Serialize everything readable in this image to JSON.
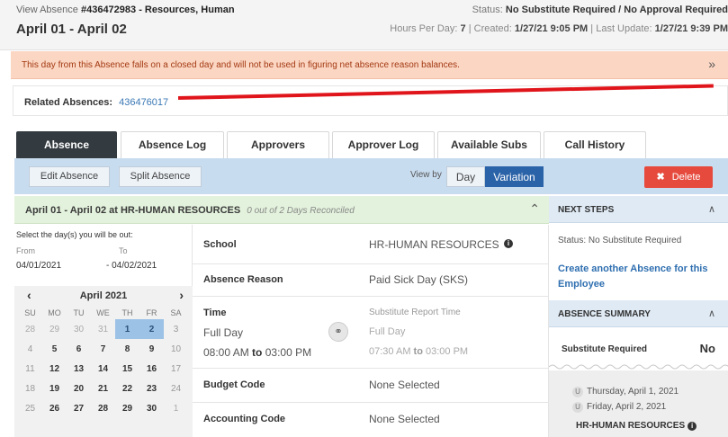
{
  "header": {
    "view_label": "View Absence",
    "absence_id": "#436472983 - Resources, Human",
    "title": "April 01 - April 02",
    "status_label": "Status:",
    "status_value": "No Substitute Required  / No Approval Required",
    "hours_label": "Hours Per Day:",
    "hours_value": "7",
    "created_label": "| Created:",
    "created_value": "1/27/21 9:05 PM",
    "updated_label": "| Last Update:",
    "updated_value": "1/27/21 9:39 PM"
  },
  "warning": {
    "message": "This day from this Absence falls on a closed day and will not be used in figuring net absence reason balances.",
    "icon": "double-chevron-down-icon"
  },
  "related": {
    "label": "Related Absences:",
    "link": "436476017"
  },
  "tabs": [
    {
      "label": "Absence",
      "active": true
    },
    {
      "label": "Absence Log"
    },
    {
      "label": "Approvers"
    },
    {
      "label": "Approver Log"
    },
    {
      "label": "Available Subs"
    },
    {
      "label": "Call History"
    }
  ],
  "toolbar": {
    "edit_label": "Edit Absence",
    "split_label": "Split Absence",
    "view_by_label": "View by",
    "day_label": "Day",
    "variation_label": "Variation",
    "delete_label": "Delete"
  },
  "section": {
    "title": "April 01 - April 02 at HR-HUMAN RESOURCES",
    "subtitle": "0 out of 2 Days Reconciled"
  },
  "dates": {
    "prompt": "Select the day(s) you will be out:",
    "from_label": "From",
    "to_label": "To",
    "from_value": "04/01/2021",
    "to_value": "- 04/02/2021"
  },
  "calendar": {
    "month": "April 2021",
    "weekdays": [
      "SU",
      "MO",
      "TU",
      "WE",
      "TH",
      "FR",
      "SA"
    ],
    "weeks": [
      [
        "28",
        "29",
        "30",
        "31",
        "1",
        "2",
        "3"
      ],
      [
        "4",
        "5",
        "6",
        "7",
        "8",
        "9",
        "10"
      ],
      [
        "11",
        "12",
        "13",
        "14",
        "15",
        "16",
        "17"
      ],
      [
        "18",
        "19",
        "20",
        "21",
        "22",
        "23",
        "24"
      ],
      [
        "25",
        "26",
        "27",
        "28",
        "29",
        "30",
        "1"
      ]
    ],
    "selected": [
      "1",
      "2"
    ]
  },
  "details": {
    "school_label": "School",
    "school_value": "HR-HUMAN RESOURCES",
    "reason_label": "Absence Reason",
    "reason_value": "Paid Sick Day (SKS)",
    "time_label": "Time",
    "time_value": "Full Day",
    "time_start": "08:00 AM",
    "time_to": "to",
    "time_end": "03:00 PM",
    "sub_time_label": "Substitute Report Time",
    "sub_time_value": "Full Day",
    "sub_time_start": "07:30 AM",
    "sub_time_to": "to",
    "sub_time_end": "03:00 PM",
    "budget_label": "Budget Code",
    "budget_value": "None Selected",
    "accounting_label": "Accounting Code",
    "accounting_value": "None Selected"
  },
  "next_steps": {
    "title": "NEXT STEPS",
    "status": "Status: No Substitute Required",
    "create_link": "Create another Absence for this Employee"
  },
  "summary": {
    "title": "ABSENCE SUMMARY",
    "sub_required_label": "Substitute Required",
    "sub_required_value": "No",
    "day1": "Thursday, April 1, 2021",
    "day2": "Friday, April 2, 2021",
    "badge": "U",
    "location": "HR-HUMAN RESOURCES"
  }
}
